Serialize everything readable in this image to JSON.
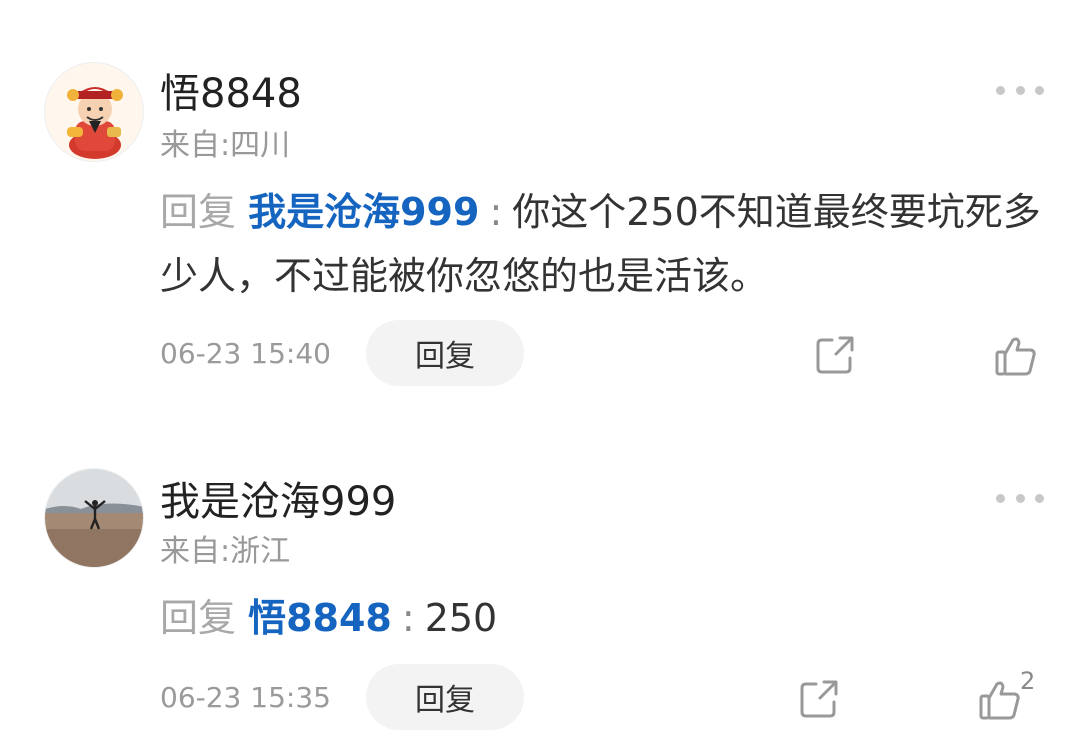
{
  "comments": [
    {
      "username": "悟8848",
      "location": "来自:四川",
      "reply_prefix": "回复",
      "mention": "我是沧海999",
      "colon": ":",
      "text": "你这个250不知道最终要坑死多少人，不过能被你忽悠的也是活该。",
      "timestamp": "06-23 15:40",
      "reply_button": "回复",
      "like_count": ""
    },
    {
      "username": "我是沧海999",
      "location": "来自:浙江",
      "reply_prefix": "回复",
      "mention": "悟8848",
      "colon": ":",
      "text": "250",
      "timestamp": "06-23 15:35",
      "reply_button": "回复",
      "like_count": "2"
    }
  ],
  "icons": {
    "more": "more-dots-icon",
    "share": "share-icon",
    "like": "thumbs-up-icon"
  },
  "colors": {
    "mention": "#1565c0",
    "meta": "#999999",
    "button_bg": "#f3f3f3"
  }
}
